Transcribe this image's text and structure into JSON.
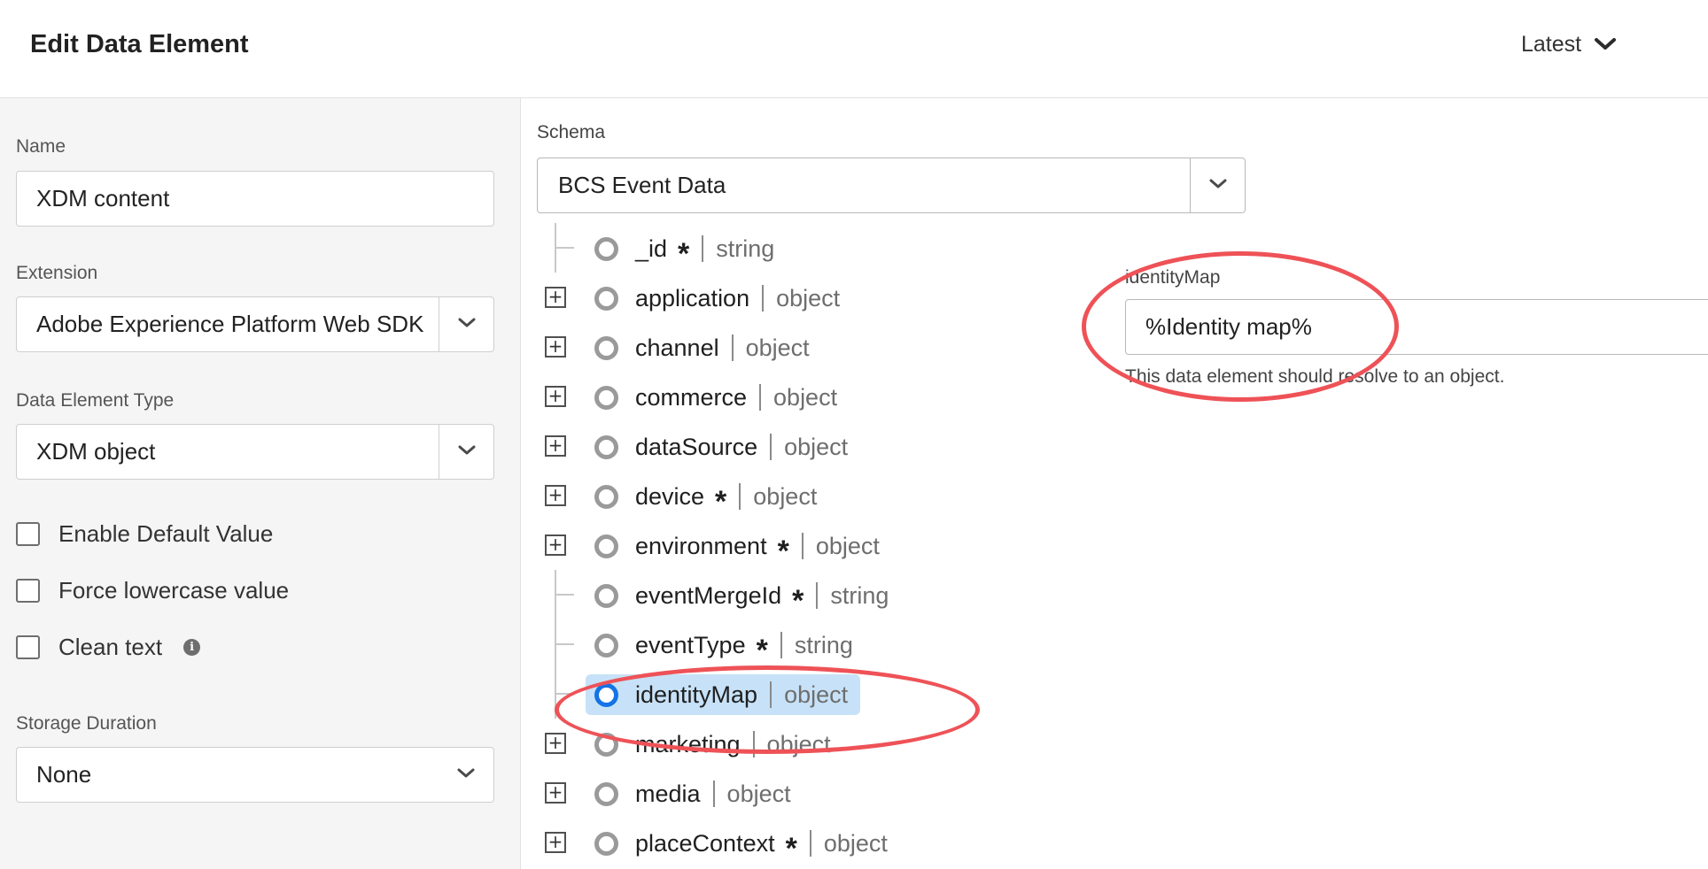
{
  "header": {
    "title": "Edit Data Element",
    "version_label": "Latest"
  },
  "sidebar": {
    "name_label": "Name",
    "name_value": "XDM content",
    "extension_label": "Extension",
    "extension_value": "Adobe Experience Platform Web SDK",
    "type_label": "Data Element Type",
    "type_value": "XDM object",
    "checkboxes": [
      {
        "label": "Enable Default Value",
        "checked": false
      },
      {
        "label": "Force lowercase value",
        "checked": false
      },
      {
        "label": "Clean text",
        "checked": false,
        "info_icon": "info-icon"
      }
    ],
    "storage_label": "Storage Duration",
    "storage_value": "None"
  },
  "schema": {
    "label": "Schema",
    "value": "BCS Event Data"
  },
  "tree": {
    "items": [
      {
        "name": "_id",
        "required": "*",
        "type": "string",
        "expandable": false,
        "selected": false
      },
      {
        "name": "application",
        "required": "",
        "type": "object",
        "expandable": true,
        "selected": false
      },
      {
        "name": "channel",
        "required": "",
        "type": "object",
        "expandable": true,
        "selected": false
      },
      {
        "name": "commerce",
        "required": "",
        "type": "object",
        "expandable": true,
        "selected": false
      },
      {
        "name": "dataSource",
        "required": "",
        "type": "object",
        "expandable": true,
        "selected": false
      },
      {
        "name": "device",
        "required": "*",
        "type": "object",
        "expandable": true,
        "selected": false
      },
      {
        "name": "environment",
        "required": "*",
        "type": "object",
        "expandable": true,
        "selected": false
      },
      {
        "name": "eventMergeId",
        "required": "*",
        "type": "string",
        "expandable": false,
        "selected": false
      },
      {
        "name": "eventType",
        "required": "*",
        "type": "string",
        "expandable": false,
        "selected": false
      },
      {
        "name": "identityMap",
        "required": "",
        "type": "object",
        "expandable": false,
        "selected": true
      },
      {
        "name": "marketing",
        "required": "",
        "type": "object",
        "expandable": true,
        "selected": false
      },
      {
        "name": "media",
        "required": "",
        "type": "object",
        "expandable": true,
        "selected": false
      },
      {
        "name": "placeContext",
        "required": "*",
        "type": "object",
        "expandable": true,
        "selected": false
      }
    ],
    "expand_glyph": "+"
  },
  "identity_map": {
    "label": "identityMap",
    "value": "%Identity map%",
    "help": "This data element should resolve to an object."
  },
  "colors": {
    "annotation": "#ee5257",
    "selection": "#c7e2f8",
    "accent": "#1473e6"
  }
}
